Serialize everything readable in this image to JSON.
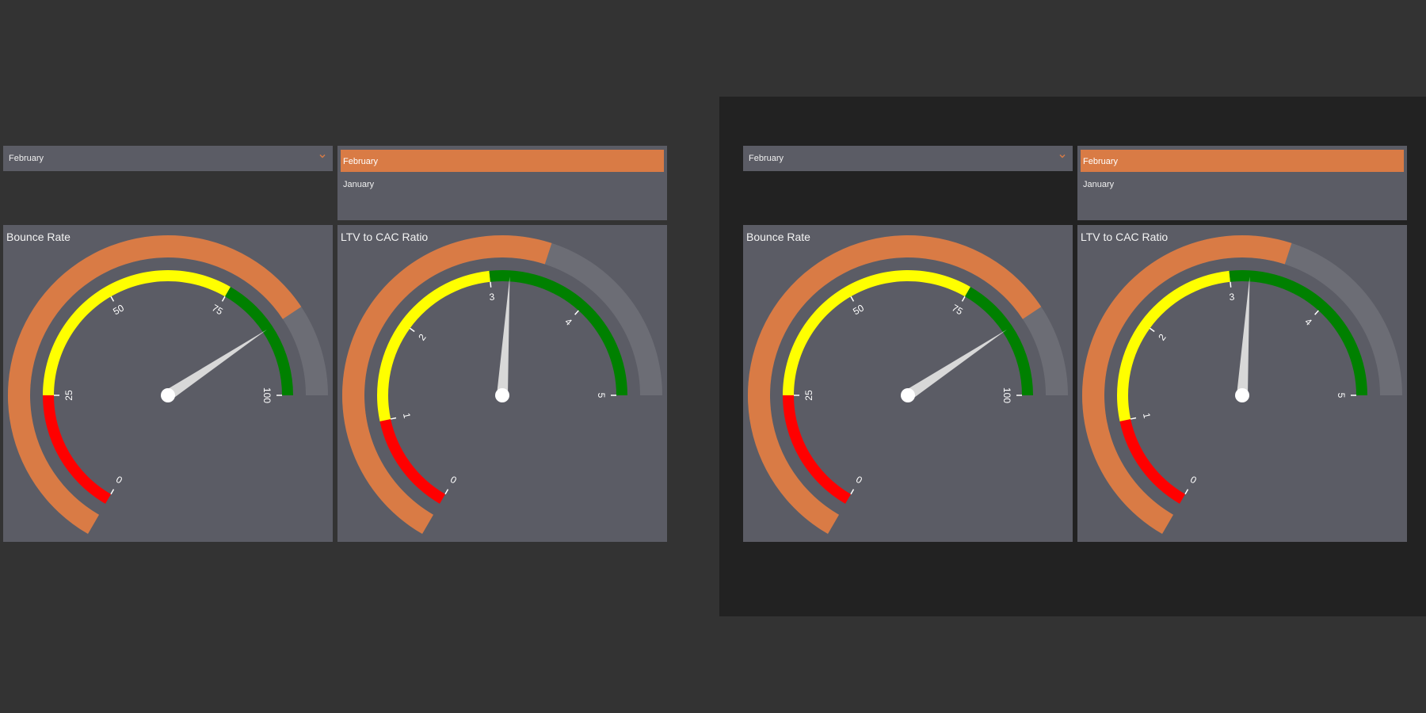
{
  "colors": {
    "page_bg": "#333333",
    "backdrop_dark": "#222222",
    "panel_bg": "#5b5c65",
    "accent_orange": "#d97b45",
    "band_red": "#ff0000",
    "band_yellow": "#ffff00",
    "band_green": "#008000",
    "track_gray": "#6c6d75",
    "needle": "#d8d8d8"
  },
  "dashboards": [
    {
      "month_dropdown": {
        "selected": "February",
        "icon": "chevron-down-icon"
      },
      "month_list": {
        "options": [
          "February",
          "January"
        ],
        "selected_index": 0
      },
      "gauges": [
        {
          "title": "Bounce Rate",
          "min": 0,
          "max": 100,
          "value": 86,
          "needle_value": 86,
          "ticks": [
            "0",
            "25",
            "50",
            "75",
            "100"
          ],
          "bands": [
            {
              "from": 0,
              "to": 25,
              "color": "red"
            },
            {
              "from": 25,
              "to": 75,
              "color": "yellow"
            },
            {
              "from": 75,
              "to": 100,
              "color": "green"
            }
          ]
        },
        {
          "title": "LTV to CAC Ratio",
          "min": 0,
          "max": 5,
          "value": 3.5,
          "needle_value": 3.2,
          "ticks": [
            "0",
            "1",
            "2",
            "3",
            "4",
            "5"
          ],
          "bands": [
            {
              "from": 0,
              "to": 1,
              "color": "red"
            },
            {
              "from": 1,
              "to": 3,
              "color": "yellow"
            },
            {
              "from": 3,
              "to": 5,
              "color": "green"
            }
          ]
        }
      ]
    },
    {
      "month_dropdown": {
        "selected": "February",
        "icon": "chevron-down-icon"
      },
      "month_list": {
        "options": [
          "February",
          "January"
        ],
        "selected_index": 0
      },
      "gauges": [
        {
          "title": "Bounce Rate",
          "min": 0,
          "max": 100,
          "value": 86,
          "needle_value": 86,
          "ticks": [
            "0",
            "25",
            "50",
            "75",
            "100"
          ],
          "bands": [
            {
              "from": 0,
              "to": 25,
              "color": "red"
            },
            {
              "from": 25,
              "to": 75,
              "color": "yellow"
            },
            {
              "from": 75,
              "to": 100,
              "color": "green"
            }
          ]
        },
        {
          "title": "LTV to CAC Ratio",
          "min": 0,
          "max": 5,
          "value": 3.5,
          "needle_value": 3.2,
          "ticks": [
            "0",
            "1",
            "2",
            "3",
            "4",
            "5"
          ],
          "bands": [
            {
              "from": 0,
              "to": 1,
              "color": "red"
            },
            {
              "from": 1,
              "to": 3,
              "color": "yellow"
            },
            {
              "from": 3,
              "to": 5,
              "color": "green"
            }
          ]
        }
      ]
    }
  ]
}
